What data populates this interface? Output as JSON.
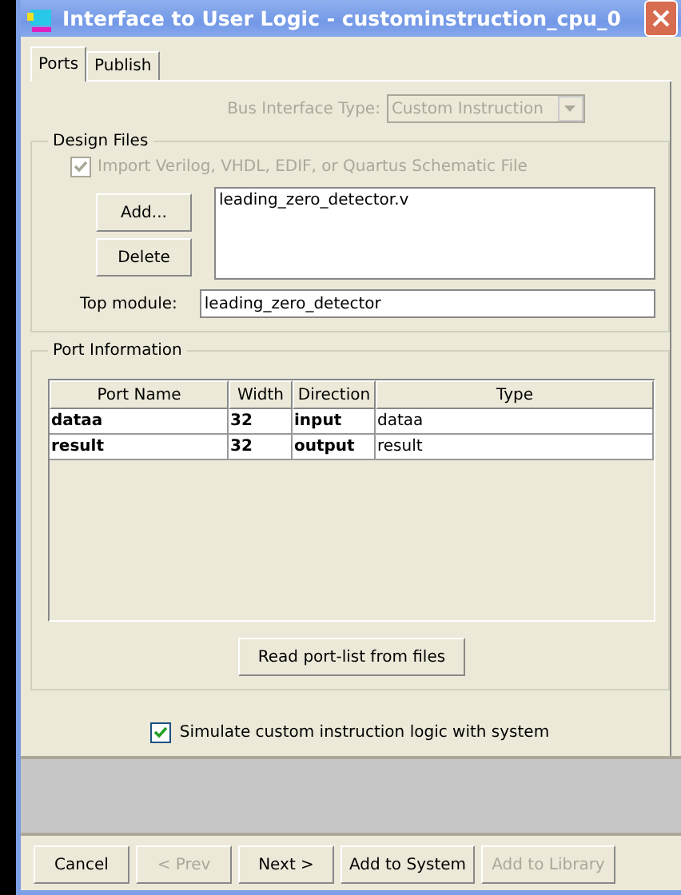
{
  "window": {
    "title": "Interface to User Logic - custominstruction_cpu_0"
  },
  "tabs": [
    {
      "label": "Ports",
      "selected": true
    },
    {
      "label": "Publish",
      "selected": false
    }
  ],
  "bus_interface": {
    "label": "Bus Interface Type:",
    "value": "Custom Instruction",
    "disabled": true
  },
  "design_files": {
    "title": "Design Files",
    "import_checkbox": {
      "label": "Import Verilog, VHDL, EDIF, or Quartus Schematic File",
      "checked": true,
      "disabled": true
    },
    "buttons": [
      "Add...",
      "Delete"
    ],
    "files": [
      "leading_zero_detector.v"
    ],
    "top_module": {
      "label": "Top module:",
      "value": "leading_zero_detector"
    }
  },
  "port_information": {
    "title": "Port Information",
    "columns": [
      "Port Name",
      "Width",
      "Direction",
      "Type"
    ],
    "rows": [
      [
        "dataa",
        "32",
        "input",
        "dataa"
      ],
      [
        "result",
        "32",
        "output",
        "result"
      ]
    ],
    "read_button": "Read port-list from files"
  },
  "simulate_checkbox": {
    "label": "Simulate custom instruction logic with system",
    "checked": true
  },
  "buttons": [
    {
      "label": "Cancel",
      "disabled": false
    },
    {
      "label": "< Prev",
      "disabled": true
    },
    {
      "label": "Next >",
      "disabled": false
    },
    {
      "label": "Add to System",
      "disabled": false
    },
    {
      "label": "Add to Library",
      "disabled": true
    }
  ]
}
